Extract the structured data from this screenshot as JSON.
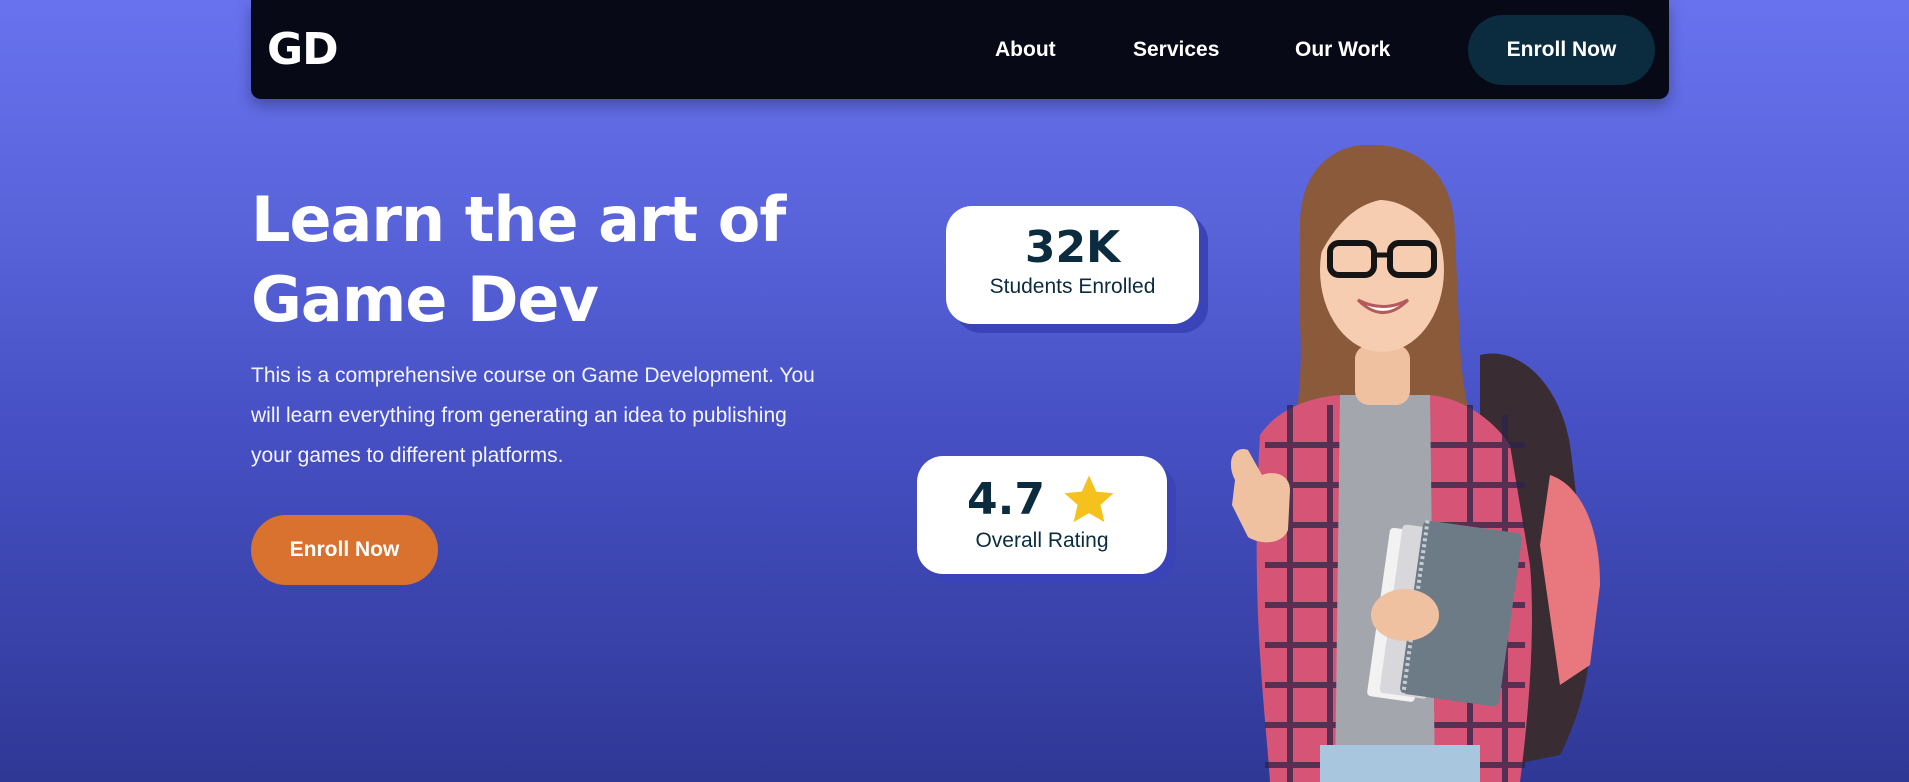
{
  "nav": {
    "logo": "GD",
    "links": [
      "About",
      "Services",
      "Our Work"
    ],
    "cta": "Enroll Now"
  },
  "hero": {
    "title_line1": "Learn the art of",
    "title_line2": "Game Dev",
    "description": "This is a comprehensive course on Game Development. You will learn everything from generating an idea to publishing your games to different platforms.",
    "cta": "Enroll Now"
  },
  "stats": {
    "students": {
      "value": "32K",
      "label": "Students Enrolled"
    },
    "rating": {
      "value": "4.7",
      "label": "Overall Rating",
      "icon": "star-icon"
    }
  },
  "colors": {
    "nav_bg": "#070a16",
    "nav_cta_bg": "#0b2b3f",
    "hero_cta_bg": "#d9722e",
    "gradient_top": "#6872ee",
    "gradient_bottom": "#2f3895",
    "star": "#f5c11d"
  }
}
